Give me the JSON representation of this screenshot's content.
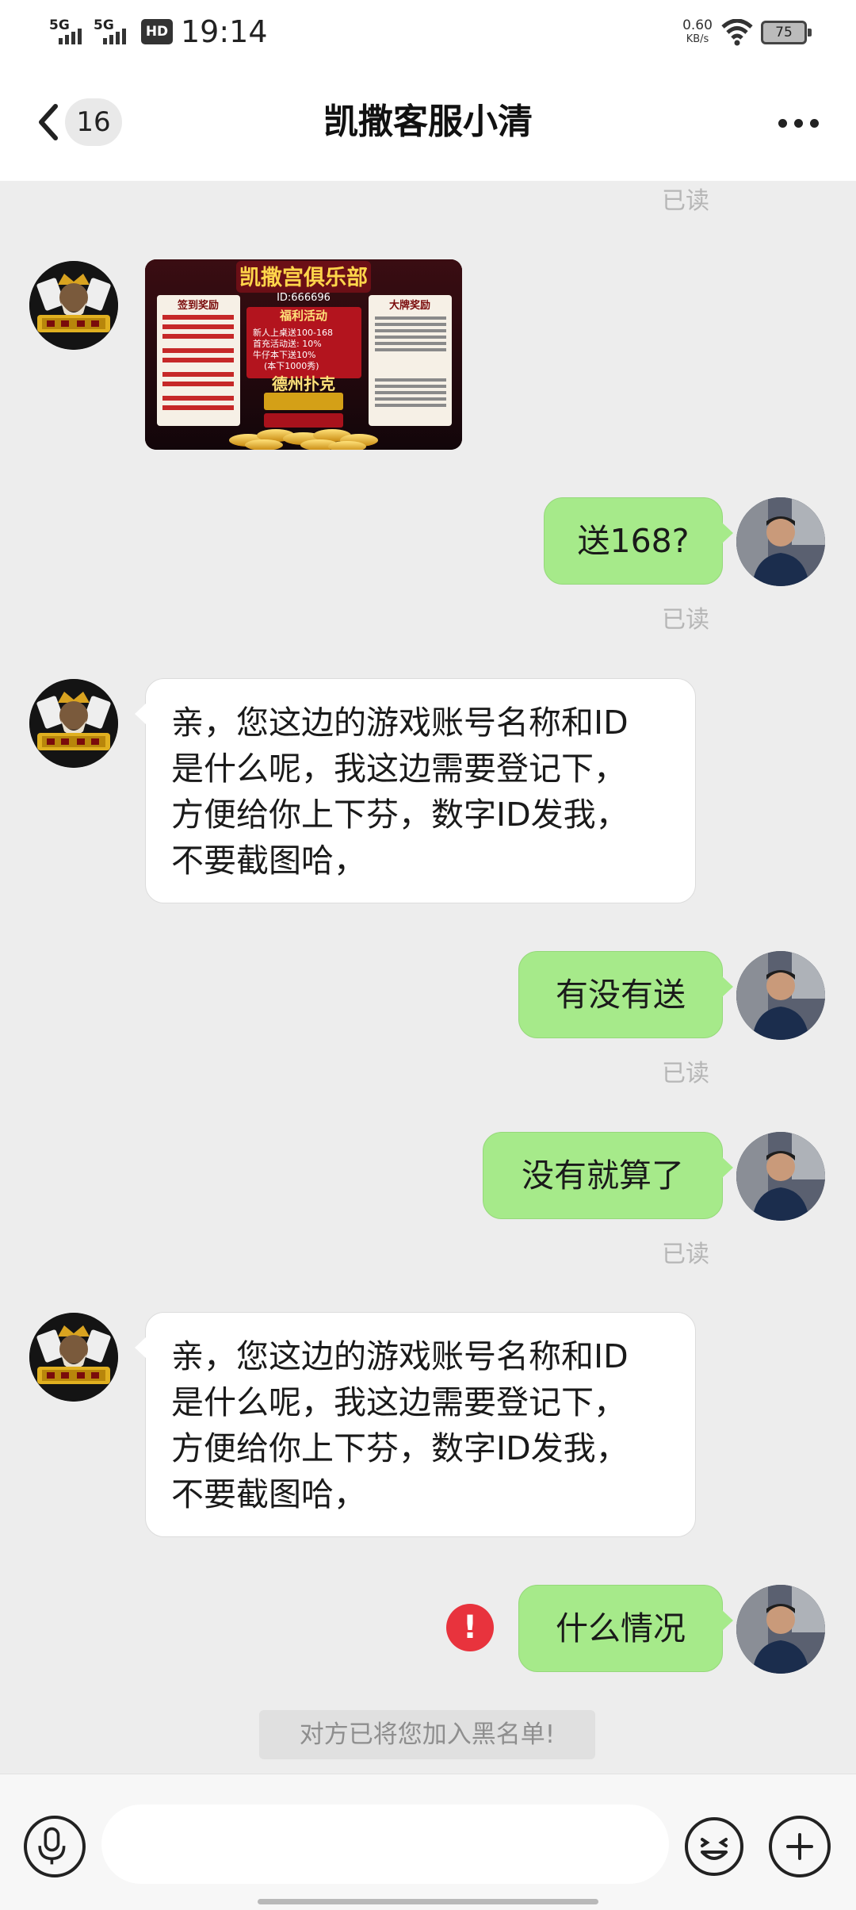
{
  "status_bar": {
    "signal1_label": "5G",
    "signal2_label": "5G",
    "hd_label": "HD",
    "time": "19:14",
    "speed_value": "0.60",
    "speed_unit": "KB/s",
    "battery": "75"
  },
  "header": {
    "unread_count": "16",
    "title": "凯撒客服小清"
  },
  "messages": {
    "read_1": "已读",
    "promo": {
      "title": "凯撒宫俱乐部",
      "id": "ID:666696",
      "left_panel": "签到奖励",
      "center_panel": "福利活动",
      "welfare_lines": [
        "新人上桌送100-168",
        "首充活动送: 10%",
        "牛仔本下送10%",
        "(本下1000秀)"
      ],
      "right_panel": "大牌奖励",
      "game": "德州扑克"
    },
    "out_1": "送168?",
    "read_2": "已读",
    "in_1": "亲，您这边的游戏账号名称和ID\n是什么呢，我这边需要登记下，\n方便给你上下芬，数字ID发我，\n不要截图哈，",
    "out_2": "有没有送",
    "read_3": "已读",
    "out_3": "没有就算了",
    "read_4": "已读",
    "in_2": "亲，您这边的游戏账号名称和ID\n是什么呢，我这边需要登记下，\n方便给你上下芬，数字ID发我，\n不要截图哈，",
    "out_4": "什么情况",
    "error_mark": "!"
  },
  "system_notice": "对方已将您加入黑名单!",
  "input": {
    "placeholder": ""
  },
  "colors": {
    "outgoing_bubble": "#a6ea8a",
    "incoming_bubble": "#ffffff",
    "chat_background": "#ededed",
    "error": "#e8333d"
  },
  "icons": [
    "back-icon",
    "more-icon",
    "microphone-icon",
    "emoji-icon",
    "plus-icon",
    "wifi-icon",
    "battery-icon"
  ]
}
